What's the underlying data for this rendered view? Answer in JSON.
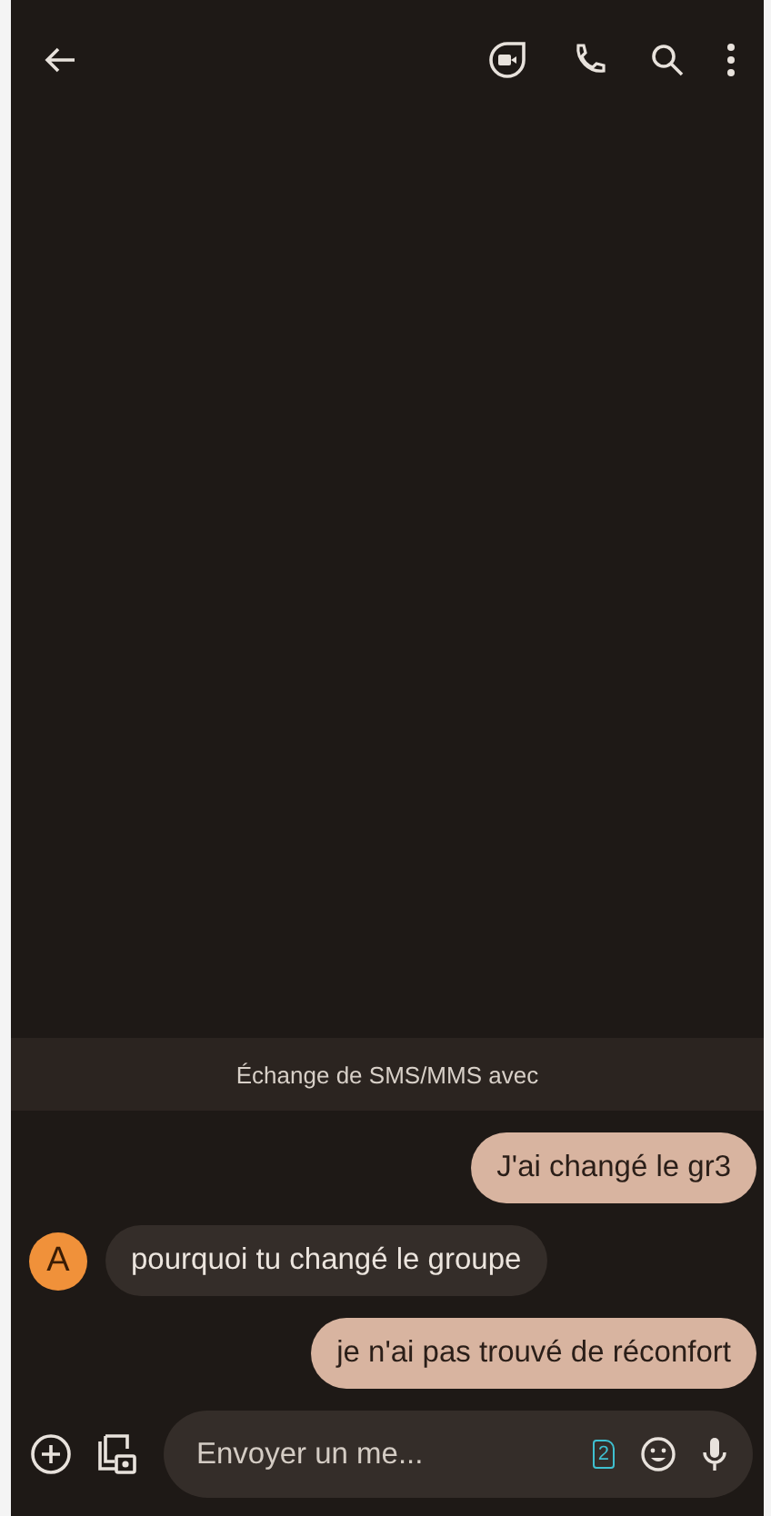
{
  "banner": {
    "text": "Échange de SMS/MMS avec"
  },
  "messages": [
    {
      "kind": "outgoing",
      "text": "J'ai changé le gr3"
    },
    {
      "kind": "incoming",
      "avatar": {
        "letter": "A",
        "color": "#f0913a"
      },
      "text": "pourquoi tu changé le groupe"
    },
    {
      "kind": "outgoing",
      "text": "je n'ai pas trouvé de réconfort"
    }
  ],
  "composer": {
    "placeholder": "Envoyer un me...",
    "sim_badge": "2"
  }
}
